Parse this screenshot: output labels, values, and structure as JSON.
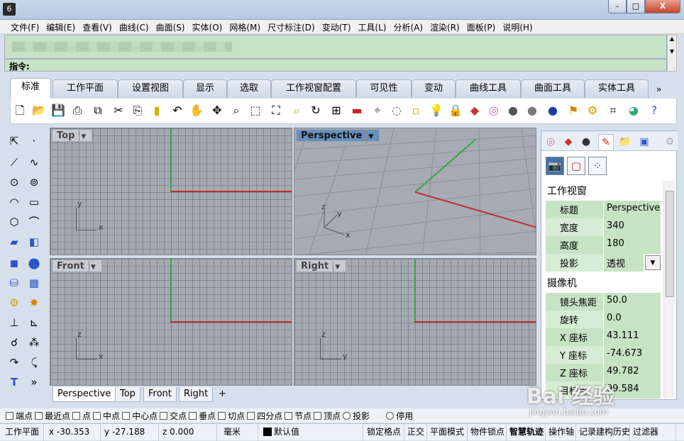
{
  "menu": [
    "文件(F)",
    "编辑(E)",
    "查看(V)",
    "曲线(C)",
    "曲面(S)",
    "实体(O)",
    "网格(M)",
    "尺寸标注(D)",
    "变动(T)",
    "工具(L)",
    "分析(A)",
    "渲染(R)",
    "面板(P)",
    "说明(H)"
  ],
  "window": {
    "minimize": "–",
    "maximize": "□",
    "close": "X"
  },
  "command": {
    "prompt": "指令:"
  },
  "tabs": [
    "标准",
    "工作平面",
    "设置视图",
    "显示",
    "选取",
    "工作视窗配置",
    "可见性",
    "变动",
    "曲线工具",
    "曲面工具",
    "实体工具"
  ],
  "tabs_more": "»",
  "toolbar_icons": [
    "new-icon",
    "open-icon",
    "save-icon",
    "print-icon",
    "import-icon",
    "cut-icon",
    "copy-icon",
    "paste-icon",
    "undo-icon",
    "pan-hand-icon",
    "rotate-view-icon",
    "zoom-icon",
    "zoom-window-icon",
    "zoom-extents-icon",
    "zoom-selected-icon",
    "rotate-icon",
    "four-viewports-icon",
    "car-icon",
    "dimension-icon",
    "circle-icon",
    "point-icon",
    "light-bulb-icon",
    "lock-icon",
    "layer-icon",
    "color-wheel-icon",
    "render-sphere-icon",
    "shaded-sphere-icon",
    "blue-sphere-icon",
    "flag-icon",
    "gear-icon",
    "grid-snap-icon",
    "globe-icon",
    "help-icon"
  ],
  "viewports": {
    "top": {
      "label": "Top",
      "axis1": "y",
      "axis2": "x"
    },
    "perspective": {
      "label": "Perspective",
      "axis1": "z",
      "axis2": "y",
      "axis3": "x"
    },
    "front": {
      "label": "Front",
      "axis1": "z",
      "axis2": "x"
    },
    "right": {
      "label": "Right",
      "axis1": "z",
      "axis2": "y"
    }
  },
  "viewport_tabs": [
    "Perspective",
    "Top",
    "Front",
    "Right"
  ],
  "viewport_tab_add": "+",
  "panel": {
    "section_view": "工作视窗",
    "props_view": [
      {
        "k": "标题",
        "v": "Perspective"
      },
      {
        "k": "宽度",
        "v": "340"
      },
      {
        "k": "高度",
        "v": "180"
      },
      {
        "k": "投影",
        "v": "透视"
      }
    ],
    "section_camera": "摄像机",
    "props_camera": [
      {
        "k": "镜头焦距",
        "v": "50.0"
      },
      {
        "k": "旋转",
        "v": "0.0"
      },
      {
        "k": "X 座标",
        "v": "43.111"
      },
      {
        "k": "Y 座标",
        "v": "-74.673"
      },
      {
        "k": "Z 座标",
        "v": "49.782"
      },
      {
        "k": "目标点",
        "v": "99.584"
      }
    ]
  },
  "osnaps": [
    "端点",
    "最近点",
    "点",
    "中点",
    "中心点",
    "交点",
    "垂点",
    "切点",
    "四分点",
    "节点",
    "顶点",
    "投影",
    "停用"
  ],
  "status": {
    "cplane": "工作平面",
    "x": "x -30.353",
    "y": "y -27.188",
    "z": "z 0.000",
    "units": "毫米",
    "layer": "默认值",
    "grid_snap": "锁定格点",
    "ortho": "正交",
    "planar": "平面模式",
    "osnap": "物件锁点",
    "smarttrack": "智慧轨迹",
    "gumball": "操作轴",
    "history": "记录建构历史",
    "filter": "过滤器"
  },
  "watermark": {
    "main": "Bai 经验",
    "sub": "jingyan.baidu.com"
  }
}
